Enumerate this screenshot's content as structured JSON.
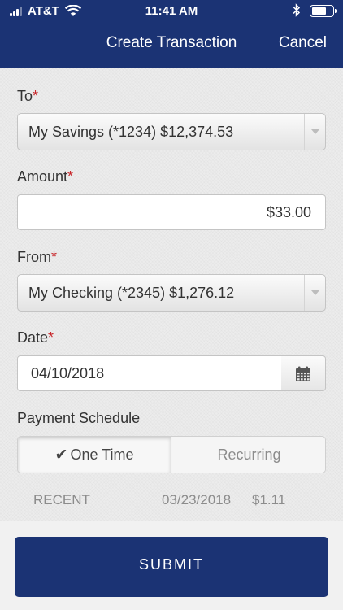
{
  "status_bar": {
    "carrier": "AT&T",
    "time": "11:41 AM",
    "battery_fraction": 0.75,
    "icons": [
      "cellular-signal-icon",
      "wifi-icon",
      "bluetooth-icon",
      "battery-icon"
    ]
  },
  "header": {
    "title": "Create Transaction",
    "cancel_label": "Cancel",
    "bg_color": "#1b3374"
  },
  "form": {
    "to": {
      "label": "To",
      "required_mark": "*",
      "value": "My Savings (*1234)  $12,374.53"
    },
    "amount": {
      "label": "Amount",
      "required_mark": "*",
      "value": "$33.00"
    },
    "from": {
      "label": "From",
      "required_mark": "*",
      "value": "My Checking (*2345)  $1,276.12"
    },
    "date": {
      "label": "Date",
      "required_mark": "*",
      "value": "04/10/2018",
      "icon": "calendar-icon"
    },
    "schedule": {
      "label": "Payment Schedule",
      "options": [
        "One Time",
        "Recurring"
      ],
      "selected": "One Time",
      "check_icon": "checkmark-icon"
    }
  },
  "recent": {
    "label": "RECENT",
    "date": "03/23/2018",
    "amount": "$1.11"
  },
  "footer": {
    "submit_label": "SUBMIT",
    "button_color": "#1b3374"
  }
}
